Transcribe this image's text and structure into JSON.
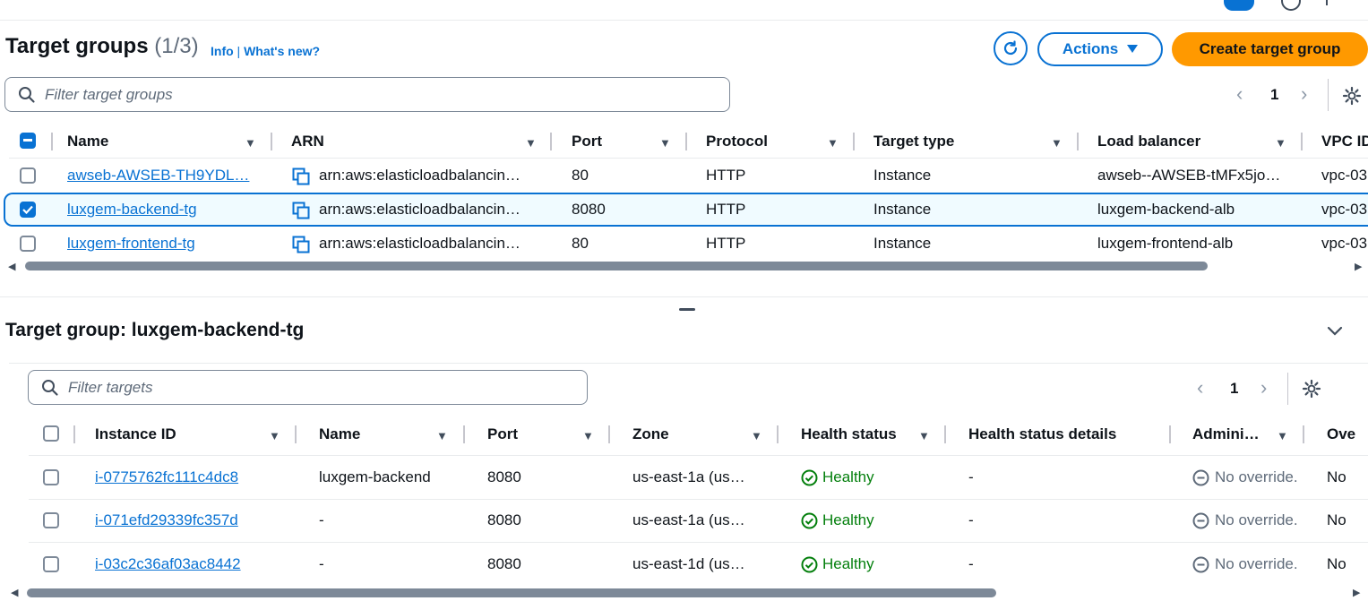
{
  "header": {
    "title": "Target groups",
    "count": "(1/3)",
    "info_link": "Info",
    "separator": "|",
    "whats_new_link": "What's new?",
    "actions_label": "Actions",
    "create_label": "Create target group"
  },
  "filter_groups": {
    "placeholder": "Filter target groups"
  },
  "pager_groups": {
    "page": "1"
  },
  "groups_table": {
    "columns": [
      "Name",
      "ARN",
      "Port",
      "Protocol",
      "Target type",
      "Load balancer",
      "VPC ID"
    ],
    "rows": [
      {
        "name": "awseb-AWSEB-TH9YDL…",
        "arn": "arn:aws:elasticloadbalancin…",
        "port": "80",
        "protocol": "HTTP",
        "target_type": "Instance",
        "load_balancer": "awseb--AWSEB-tMFx5jo…",
        "vpc": "vpc-03",
        "selected": false
      },
      {
        "name": "luxgem-backend-tg",
        "arn": "arn:aws:elasticloadbalancin…",
        "port": "8080",
        "protocol": "HTTP",
        "target_type": "Instance",
        "load_balancer": "luxgem-backend-alb",
        "vpc": "vpc-03",
        "selected": true
      },
      {
        "name": "luxgem-frontend-tg",
        "arn": "arn:aws:elasticloadbalancin…",
        "port": "80",
        "protocol": "HTTP",
        "target_type": "Instance",
        "load_balancer": "luxgem-frontend-alb",
        "vpc": "vpc-03",
        "selected": false
      }
    ]
  },
  "details": {
    "title": "Target group: luxgem-backend-tg",
    "filter_placeholder": "Filter targets",
    "page": "1",
    "columns": [
      "Instance ID",
      "Name",
      "Port",
      "Zone",
      "Health status",
      "Health status details",
      "Admini…",
      "Ove"
    ],
    "rows": [
      {
        "instance_id": "i-0775762fc111c4dc8",
        "name": "luxgem-backend",
        "port": "8080",
        "zone": "us-east-1a (us…",
        "health": "Healthy",
        "health_details": "-",
        "admin": "No override.",
        "override": "No"
      },
      {
        "instance_id": "i-071efd29339fc357d",
        "name": "-",
        "port": "8080",
        "zone": "us-east-1a (us…",
        "health": "Healthy",
        "health_details": "-",
        "admin": "No override.",
        "override": "No"
      },
      {
        "instance_id": "i-03c2c36af03ac8442",
        "name": "-",
        "port": "8080",
        "zone": "us-east-1d (us…",
        "health": "Healthy",
        "health_details": "-",
        "admin": "No override.",
        "override": "No"
      }
    ]
  },
  "colors": {
    "primary": "#0972d3",
    "accent": "#ff9900",
    "success": "#037f0c"
  }
}
